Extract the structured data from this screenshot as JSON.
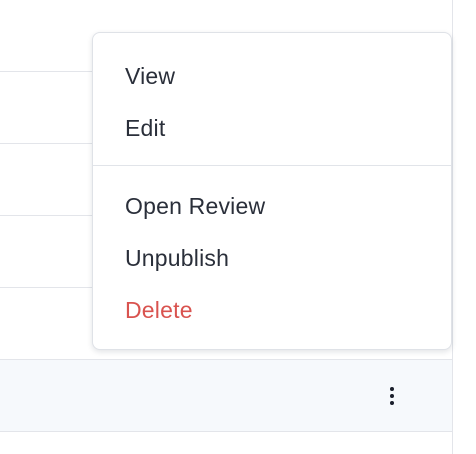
{
  "menu": {
    "items": [
      {
        "label": "View"
      },
      {
        "label": "Edit"
      },
      {
        "label": "Open Review"
      },
      {
        "label": "Unpublish"
      },
      {
        "label": "Delete"
      }
    ]
  },
  "colors": {
    "danger": "#d9534f",
    "text": "#2a2f3a",
    "row_highlight": "#f6f9fc",
    "border": "#e3e5ea"
  },
  "icons": {
    "more": "more-vertical-icon"
  }
}
